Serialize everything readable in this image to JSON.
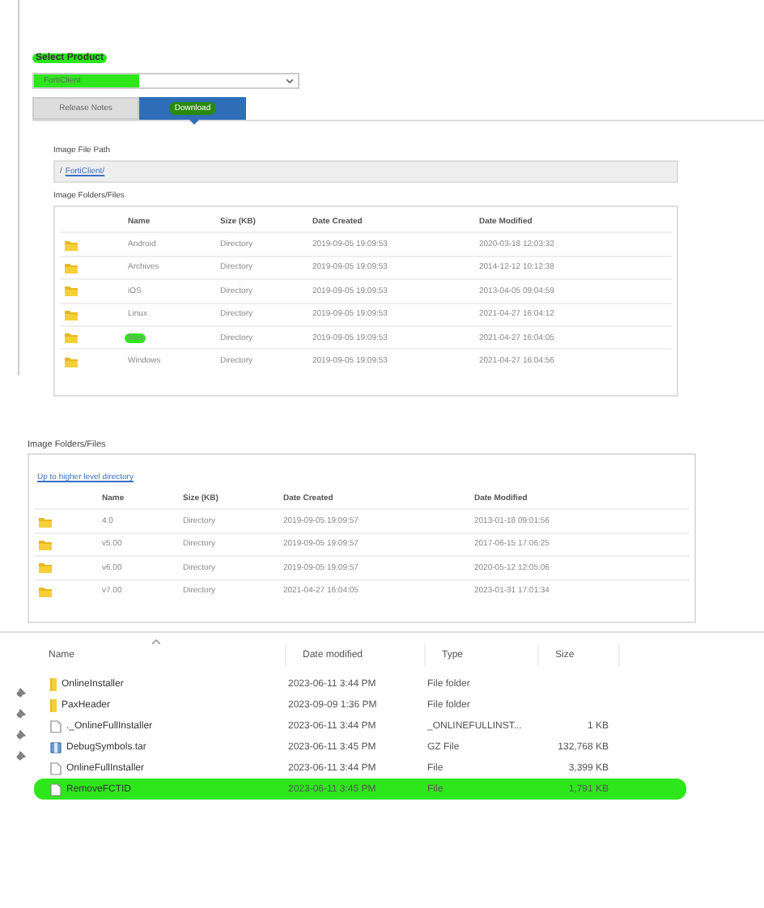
{
  "download_page": {
    "product_label": {
      "text": "Select Product",
      "highlighted": true
    },
    "product_select": {
      "value": "FortiClient",
      "highlighted": true
    },
    "tabs": [
      {
        "label": "Release Notes",
        "selected": false,
        "highlighted": false
      },
      {
        "label": "Download",
        "selected": true,
        "highlighted": true
      }
    ],
    "path_label": "Image File Path",
    "path": {
      "prefix": "/",
      "link": "FortiClient/"
    },
    "files_label": "Image Folders/Files",
    "columns": [
      "Name",
      "Size (KB)",
      "Date Created",
      "Date Modified"
    ],
    "rows": [
      {
        "name": "Android",
        "size": "Directory",
        "created": "2019-09-05 19:09:53",
        "modified": "2020-03-18 12:03:32",
        "highlighted": false
      },
      {
        "name": "Archives",
        "size": "Directory",
        "created": "2019-09-05 19:09:53",
        "modified": "2014-12-12 10:12:38",
        "highlighted": false
      },
      {
        "name": "iOS",
        "size": "Directory",
        "created": "2019-09-05 19:09:53",
        "modified": "2013-04-05 09:04:59",
        "highlighted": false
      },
      {
        "name": "Linux",
        "size": "Directory",
        "created": "2019-09-05 19:09:53",
        "modified": "2021-04-27 16:04:12",
        "highlighted": false
      },
      {
        "name": "Mac",
        "size": "Directory",
        "created": "2019-09-05 19:09:53",
        "modified": "2021-04-27 16:04:05",
        "highlighted": true
      },
      {
        "name": "Windows",
        "size": "Directory",
        "created": "2019-09-05 19:09:53",
        "modified": "2021-04-27 16:04:56",
        "highlighted": false
      }
    ]
  },
  "sub_listing": {
    "files_label": "Image Folders/Files",
    "up_link": "Up to higher level directory",
    "columns": [
      "Name",
      "Size (KB)",
      "Date Created",
      "Date Modified"
    ],
    "rows": [
      {
        "name": "4.0",
        "size": "Directory",
        "created": "2019-09-05 19:09:57",
        "modified": "2013-01-18 09:01:56",
        "highlighted": false
      },
      {
        "name": "v5.00",
        "size": "Directory",
        "created": "2019-09-05 19:09:57",
        "modified": "2017-06-15 17:06:25",
        "highlighted": false
      },
      {
        "name": "v6.00",
        "size": "Directory",
        "created": "2019-09-05 19:09:57",
        "modified": "2020-05-12 12:05:06",
        "highlighted": false
      },
      {
        "name": "v7.00",
        "size": "Directory",
        "created": "2021-04-27 16:04:05",
        "modified": "2023-01-31 17:01:34",
        "highlighted": false
      }
    ]
  },
  "explorer": {
    "columns": [
      "Name",
      "Date modified",
      "Type",
      "Size"
    ],
    "rows": [
      {
        "kind": "folder",
        "name": "OnlineInstaller",
        "date": "2023-06-11 3:44 PM",
        "type": "File folder",
        "size": "",
        "highlighted": false
      },
      {
        "kind": "folder",
        "name": "PaxHeader",
        "date": "2023-09-09 1:36 PM",
        "type": "File folder",
        "size": "",
        "highlighted": false
      },
      {
        "kind": "file",
        "name": "._OnlineFullInstaller",
        "date": "2023-06-11 3:44 PM",
        "type": "_ONLINEFULLINST...",
        "size": "1 KB",
        "highlighted": false
      },
      {
        "kind": "archive",
        "name": "DebugSymbols.tar",
        "date": "2023-06-11 3:45 PM",
        "type": "GZ File",
        "size": "132,768 KB",
        "highlighted": false
      },
      {
        "kind": "file",
        "name": "OnlineFullInstaller",
        "date": "2023-06-11 3:44 PM",
        "type": "File",
        "size": "3,399 KB",
        "highlighted": false
      },
      {
        "kind": "file",
        "name": "RemoveFCTID",
        "date": "2023-06-11 3:45 PM",
        "type": "File",
        "size": "1,791 KB",
        "highlighted": true
      }
    ]
  }
}
